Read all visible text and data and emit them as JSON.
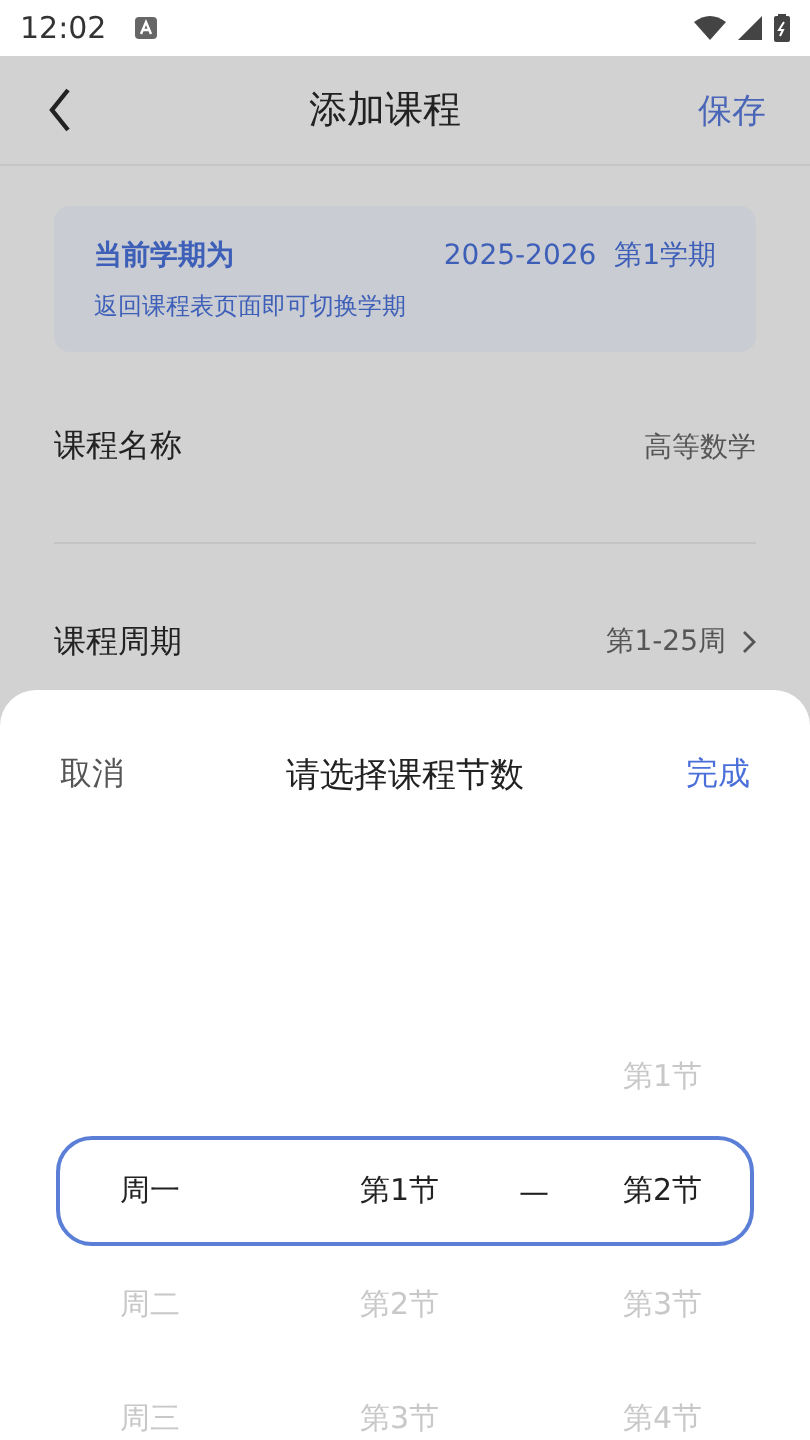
{
  "status_bar": {
    "time": "12:02"
  },
  "header": {
    "title": "添加课程",
    "action": "保存"
  },
  "semester_card": {
    "label": "当前学期为",
    "value": "2025-2026  第1学期",
    "hint": "返回课程表页面即可切换学期"
  },
  "fields": [
    {
      "label": "课程名称",
      "value": "高等数学",
      "has_arrow": false
    },
    {
      "label": "课程周期",
      "value": "第1-25周",
      "has_arrow": true
    }
  ],
  "sheet": {
    "cancel": "取消",
    "title": "请选择课程节数",
    "done": "完成",
    "separator": "—",
    "rows": [
      {
        "end": "第1节",
        "selected": false
      },
      {
        "day": "周一",
        "start": "第1节",
        "end": "第2节",
        "selected": true
      },
      {
        "day": "周二",
        "start": "第2节",
        "end": "第3节",
        "selected": false
      },
      {
        "day": "周三",
        "start": "第3节",
        "end": "第4节",
        "selected": false
      }
    ]
  }
}
